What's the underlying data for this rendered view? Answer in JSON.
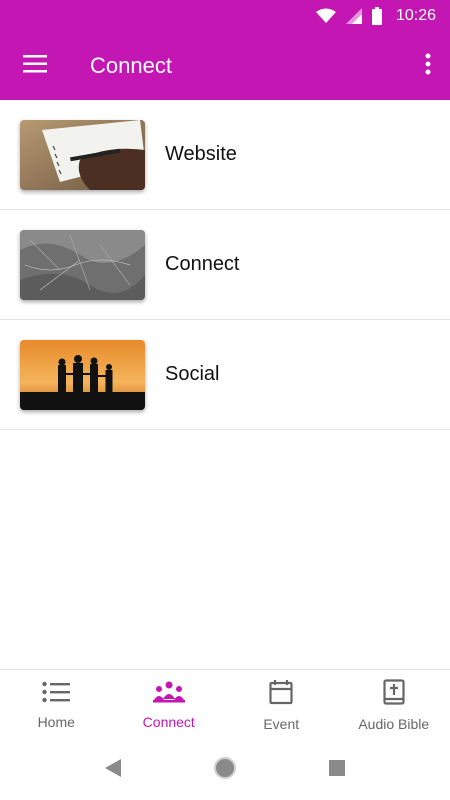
{
  "status_bar": {
    "time": "10:26",
    "icons": [
      "wifi-icon",
      "cell-signal-icon",
      "battery-icon"
    ]
  },
  "app_bar": {
    "title": "Connect",
    "left_icon": "hamburger-menu-icon",
    "right_icon": "more-vertical-icon"
  },
  "list": {
    "items": [
      {
        "label": "Website",
        "thumbnail": "hand-writing-notebook-photo"
      },
      {
        "label": "Connect",
        "thumbnail": "grey-marble-texture-photo"
      },
      {
        "label": "Social",
        "thumbnail": "family-silhouette-sunset-photo"
      }
    ]
  },
  "bottom_nav": {
    "items": [
      {
        "label": "Home",
        "icon": "list-icon",
        "active": false
      },
      {
        "label": "Connect",
        "icon": "people-group-icon",
        "active": true
      },
      {
        "label": "Event",
        "icon": "calendar-icon",
        "active": false
      },
      {
        "label": "Audio Bible",
        "icon": "bible-book-icon",
        "active": false
      }
    ]
  },
  "system_nav": {
    "icons": [
      "back-icon",
      "home-icon",
      "recents-icon"
    ]
  },
  "colors": {
    "brand": "#c316b3",
    "inactive": "#666666",
    "divider": "#e4e4e4"
  }
}
